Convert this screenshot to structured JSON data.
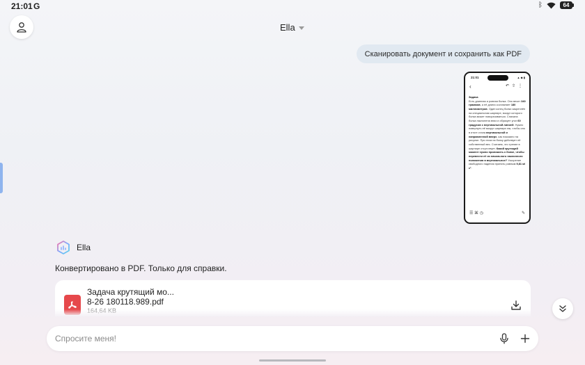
{
  "status_bar": {
    "time": "21:01",
    "g_label": "G",
    "battery": "64"
  },
  "header": {
    "title": "Ella"
  },
  "user_message": {
    "text": "Сканировать документ и сохранить как PDF"
  },
  "thumbnail": {
    "time": "21:01",
    "status_icons": "▲ ◆ ▮",
    "heading": "Задача",
    "body": [
      {
        "t": "Есть длинная и ровная болка. Оно весит "
      },
      {
        "t": "340 граммов",
        "b": true
      },
      {
        "t": ", а её длина составляет "
      },
      {
        "t": "180 миллиметров",
        "b": true
      },
      {
        "t": ". Один конец болки закреплён на специальном шарнире, вокруг которого болка может поворачиваться. Сначала болка наклонена вниз и образует угол "
      },
      {
        "t": "60 градусов с вертикальной линией",
        "b": true
      },
      {
        "t": ". Нужно повернуть её вокруг шарнира так, чтобы оно в итоге стала "
      },
      {
        "t": "вертикальной и направленной вверх",
        "b": true
      },
      {
        "t": ", как показано на рисунке. При этом на болку действует её собственный вес. Считаем, что трение в шарнире отсутствует. "
      },
      {
        "t": "Какой крутящий момент нужно приложить к болке, чтобы перевести её из начального наклонного положения в вертикальное?",
        "b": true
      },
      {
        "t": " Ускорение свободного падения принять равным "
      },
      {
        "t": "9,81 м/с²",
        "b": true
      },
      {
        "t": "."
      }
    ]
  },
  "assistant": {
    "name": "Ella",
    "message": "Конвертировано в PDF. Только для справки."
  },
  "file": {
    "name_line1": "Задача крутящий мо...",
    "name_line2": "8-26 180118.989.pdf",
    "size": "164,64 KB"
  },
  "input": {
    "placeholder": "Спросите меня!"
  },
  "colors": {
    "accent": "#e6484b",
    "user_bubble": "#e1e9f1",
    "handle": "#8fb4ee"
  },
  "icons": {
    "profile": "person-outline-icon",
    "bluetooth": "bluetooth-icon",
    "wifi": "wifi-icon",
    "pdf": "pdf-file-icon",
    "download": "download-icon",
    "scroll_down": "double-chevron-down-icon",
    "mic": "microphone-icon",
    "plus": "plus-icon",
    "assistant_logo": "hexagon-logo-icon"
  }
}
